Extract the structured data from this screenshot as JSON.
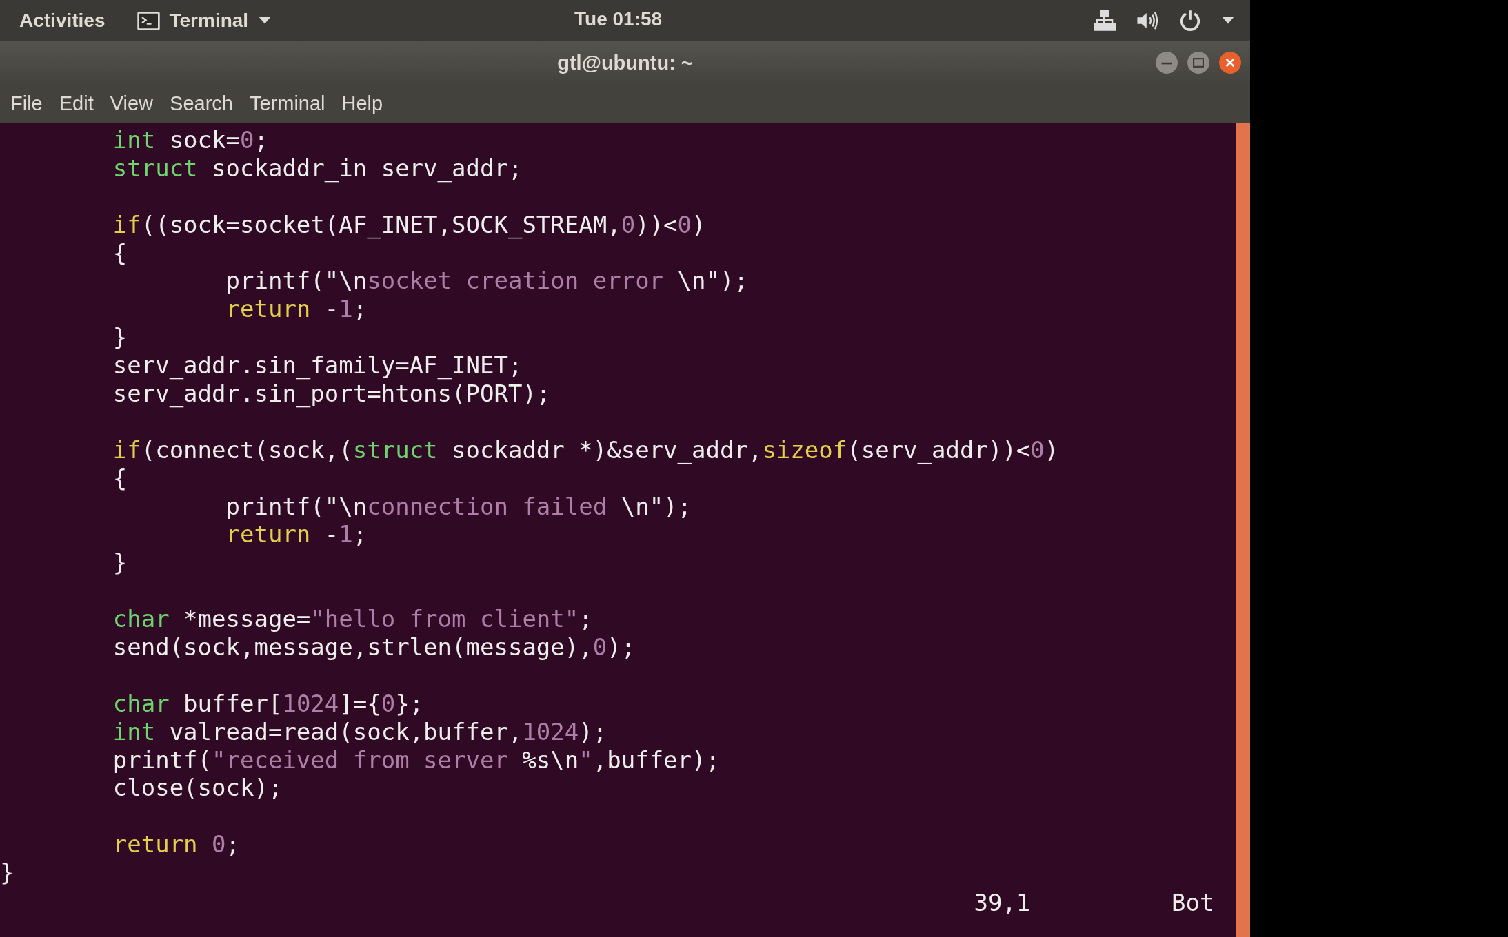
{
  "top_bar": {
    "activities": "Activities",
    "app_menu": "Terminal",
    "clock": "Tue 01:58"
  },
  "window": {
    "title": "gtl@ubuntu: ~"
  },
  "menu": [
    "File",
    "Edit",
    "View",
    "Search",
    "Terminal",
    "Help"
  ],
  "editor": {
    "lines": [
      {
        "kind": "code",
        "tokens": [
          {
            "t": "        int",
            "kind": "type"
          },
          {
            "t": " sock=",
            "kind": "plain"
          },
          {
            "t": "0",
            "kind": "constant"
          },
          {
            "t": ";",
            "kind": "plain"
          }
        ]
      },
      {
        "kind": "code",
        "tokens": [
          {
            "t": "        struct",
            "kind": "type"
          },
          {
            "t": " sockaddr_in serv_addr;",
            "kind": "plain"
          }
        ]
      },
      {
        "kind": "blank"
      },
      {
        "kind": "code",
        "tokens": [
          {
            "t": "        if",
            "kind": "keyword"
          },
          {
            "t": "((sock=socket(AF_INET,SOCK_STREAM,",
            "kind": "plain"
          },
          {
            "t": "0",
            "kind": "constant"
          },
          {
            "t": "))<",
            "kind": "plain"
          },
          {
            "t": "0",
            "kind": "constant"
          },
          {
            "t": ")",
            "kind": "plain"
          }
        ]
      },
      {
        "kind": "code",
        "tokens": [
          {
            "t": "        {",
            "kind": "plain"
          }
        ]
      },
      {
        "kind": "code",
        "tokens": [
          {
            "t": "                printf(\"\\n",
            "kind": "plain"
          },
          {
            "t": "socket creation error ",
            "kind": "constant"
          },
          {
            "t": "\\n\");",
            "kind": "plain"
          }
        ]
      },
      {
        "kind": "code",
        "tokens": [
          {
            "t": "                return",
            "kind": "keyword"
          },
          {
            "t": " -",
            "kind": "plain"
          },
          {
            "t": "1",
            "kind": "constant"
          },
          {
            "t": ";",
            "kind": "plain"
          }
        ]
      },
      {
        "kind": "code",
        "tokens": [
          {
            "t": "        }",
            "kind": "plain"
          }
        ]
      },
      {
        "kind": "code",
        "tokens": [
          {
            "t": "        serv_addr.sin_family=AF_INET;",
            "kind": "plain"
          }
        ]
      },
      {
        "kind": "code",
        "tokens": [
          {
            "t": "        serv_addr.sin_port=htons(PORT);",
            "kind": "plain"
          }
        ]
      },
      {
        "kind": "blank"
      },
      {
        "kind": "code",
        "tokens": [
          {
            "t": "        if",
            "kind": "keyword"
          },
          {
            "t": "(connect(sock,(",
            "kind": "plain"
          },
          {
            "t": "struct",
            "kind": "type"
          },
          {
            "t": " sockaddr *)&serv_addr,",
            "kind": "plain"
          },
          {
            "t": "sizeof",
            "kind": "keyword"
          },
          {
            "t": "(serv_addr))<",
            "kind": "plain"
          },
          {
            "t": "0",
            "kind": "constant"
          },
          {
            "t": ")",
            "kind": "plain"
          }
        ]
      },
      {
        "kind": "code",
        "tokens": [
          {
            "t": "        {",
            "kind": "plain"
          }
        ]
      },
      {
        "kind": "code",
        "tokens": [
          {
            "t": "                printf(\"\\n",
            "kind": "plain"
          },
          {
            "t": "connection failed ",
            "kind": "constant"
          },
          {
            "t": "\\n\");",
            "kind": "plain"
          }
        ]
      },
      {
        "kind": "code",
        "tokens": [
          {
            "t": "                return",
            "kind": "keyword"
          },
          {
            "t": " -",
            "kind": "plain"
          },
          {
            "t": "1",
            "kind": "constant"
          },
          {
            "t": ";",
            "kind": "plain"
          }
        ]
      },
      {
        "kind": "code",
        "tokens": [
          {
            "t": "        }",
            "kind": "plain"
          }
        ]
      },
      {
        "kind": "blank"
      },
      {
        "kind": "code",
        "tokens": [
          {
            "t": "        char",
            "kind": "type"
          },
          {
            "t": " *message=",
            "kind": "plain"
          },
          {
            "t": "\"hello from client\"",
            "kind": "constant"
          },
          {
            "t": ";",
            "kind": "plain"
          }
        ]
      },
      {
        "kind": "code",
        "tokens": [
          {
            "t": "        send(sock,message,strlen(message),",
            "kind": "plain"
          },
          {
            "t": "0",
            "kind": "constant"
          },
          {
            "t": ");",
            "kind": "plain"
          }
        ]
      },
      {
        "kind": "blank"
      },
      {
        "kind": "code",
        "tokens": [
          {
            "t": "        char",
            "kind": "type"
          },
          {
            "t": " buffer[",
            "kind": "plain"
          },
          {
            "t": "1024",
            "kind": "constant"
          },
          {
            "t": "]={",
            "kind": "plain"
          },
          {
            "t": "0",
            "kind": "constant"
          },
          {
            "t": "};",
            "kind": "plain"
          }
        ]
      },
      {
        "kind": "code",
        "tokens": [
          {
            "t": "        int",
            "kind": "type"
          },
          {
            "t": " valread=read(sock,buffer,",
            "kind": "plain"
          },
          {
            "t": "1024",
            "kind": "constant"
          },
          {
            "t": ");",
            "kind": "plain"
          }
        ]
      },
      {
        "kind": "code",
        "tokens": [
          {
            "t": "        printf(",
            "kind": "plain"
          },
          {
            "t": "\"received from server ",
            "kind": "constant"
          },
          {
            "t": "%s\\n",
            "kind": "plain"
          },
          {
            "t": "\"",
            "kind": "constant"
          },
          {
            "t": ",buffer);",
            "kind": "plain"
          }
        ]
      },
      {
        "kind": "code",
        "tokens": [
          {
            "t": "        close(sock);",
            "kind": "plain"
          }
        ]
      },
      {
        "kind": "blank"
      },
      {
        "kind": "code",
        "tokens": [
          {
            "t": "        return ",
            "kind": "keyword"
          },
          {
            "t": "0",
            "kind": "constant"
          },
          {
            "t": ";",
            "kind": "plain"
          }
        ]
      },
      {
        "kind": "code",
        "tokens": [
          {
            "t": "}",
            "kind": "plain"
          }
        ]
      }
    ]
  },
  "status_line": {
    "cursor": "39,1",
    "scroll": "Bot"
  }
}
